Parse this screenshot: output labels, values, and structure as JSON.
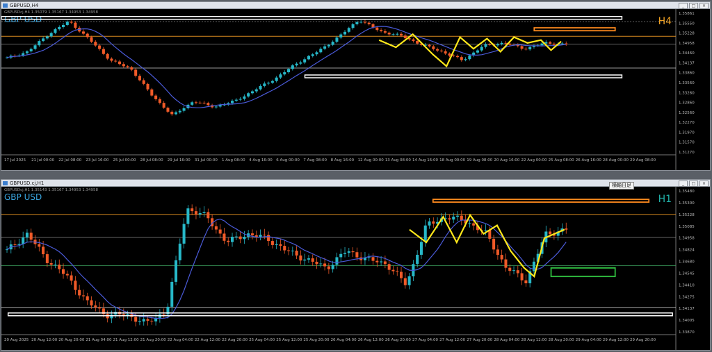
{
  "windows": [
    {
      "title": "GBPUSD,H4",
      "symbol": "GBP USD",
      "timeframe": "H4",
      "timeframe_color": "#f0a020",
      "info_line": "GBPUSDcj,H4  1.35079 1.35167 1.34953 1.34958",
      "price_labels": [
        "1.35861",
        "1.35550",
        "1.35228",
        "1.34958",
        "1.34460",
        "1.34137",
        "1.33860",
        "1.33560",
        "1.33260",
        "1.32860",
        "1.32560",
        "1.32270",
        "1.31970",
        "1.31570",
        "1.31270"
      ],
      "time_labels": [
        "17 Jul 2025",
        "21 Jul 00:00",
        "22 Jul 08:00",
        "23 Jul 16:00",
        "25 Jul 00:00",
        "28 Jul 08:00",
        "29 Jul 16:00",
        "31 Jul 00:00",
        "1 Aug 08:00",
        "4 Aug 16:00",
        "6 Aug 00:00",
        "7 Aug 08:00",
        "8 Aug 16:00",
        "12 Aug 00:00",
        "13 Aug 08:00",
        "14 Aug 16:00",
        "18 Aug 00:00",
        "19 Aug 08:00",
        "20 Aug 16:00",
        "22 Aug 00:00",
        "25 Aug 08:00",
        "26 Aug 16:00",
        "28 Aug 00:00",
        "29 Aug 08:00"
      ],
      "ylim": [
        1.3125,
        1.3607
      ],
      "levels": {
        "top_white": 1.35861,
        "orange": 1.35228,
        "current": 1.34958,
        "bottom_white": 1.34137
      },
      "zones": [
        {
          "color": "#ff8a1e",
          "low": 1.3542,
          "high": 1.3552
        }
      ],
      "colors": {
        "bull": "#27b8c8",
        "bear": "#f05a28",
        "ma": "#4a5ad8",
        "zigzag": "#ffe81a"
      }
    },
    {
      "title": "GBPUSD.cj,H1",
      "symbol": "GBP USD",
      "timeframe": "H1",
      "timeframe_color": "#20b0a8",
      "info_line": "GBPUSDcj,H1  1.35143 1.35167 1.34953 1.34958",
      "price_labels": [
        "1.35480",
        "1.35300",
        "1.35228",
        "1.35085",
        "1.34958",
        "1.34824",
        "1.34680",
        "1.34545",
        "1.34410",
        "1.34275",
        "1.34137",
        "1.34005",
        "1.33870"
      ],
      "time_labels": [
        "20 Aug 2025",
        "20 Aug 12:00",
        "20 Aug 20:00",
        "21 Aug 04:00",
        "21 Aug 12:00",
        "21 Aug 20:00",
        "22 Aug 04:00",
        "22 Aug 12:00",
        "22 Aug 20:00",
        "25 Aug 04:00",
        "25 Aug 12:00",
        "25 Aug 20:00",
        "26 Aug 04:00",
        "26 Aug 12:00",
        "26 Aug 20:00",
        "27 Aug 04:00",
        "27 Aug 12:00",
        "27 Aug 20:00",
        "28 Aug 04:00",
        "28 Aug 12:00",
        "28 Aug 20:00",
        "29 Aug 04:00",
        "29 Aug 12:00",
        "29 Aug 20:00"
      ],
      "ylim": [
        1.3385,
        1.3552
      ],
      "levels": {
        "orange": 1.35228,
        "current": 1.34958,
        "green_line": 1.34628,
        "bottom_white": 1.34137
      },
      "zones": [
        {
          "color": "#ff8a1e",
          "low": 1.35375,
          "high": 1.35405
        },
        {
          "color": "#30c040",
          "low": 1.345,
          "high": 1.346
        }
      ],
      "colors": {
        "bull": "#27b8c8",
        "bear": "#f05a28",
        "ma": "#4a5ad8",
        "zigzag": "#ffe81a"
      }
    }
  ],
  "tooltip": "横軸日足",
  "controls": {
    "min": "_",
    "max": "□",
    "close": "×"
  }
}
